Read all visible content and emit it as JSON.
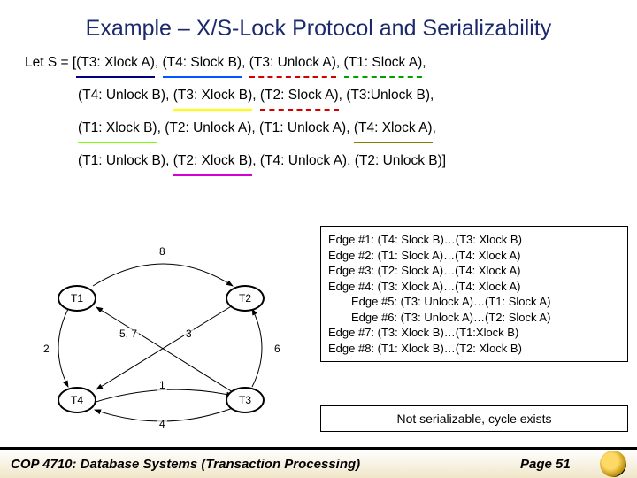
{
  "title": "Example – X/S-Lock Protocol and Serializability",
  "schedule": {
    "prefix": "Let S = [",
    "line1": {
      "a": "(T3: Xlock A)",
      "sep1": ", ",
      "b": "(T4: Slock B)",
      "sep2": ", ",
      "c": "(T3: Unlock A)",
      "sep3": ", ",
      "d": "(T1: Slock A)",
      "end": ","
    },
    "line2": {
      "a": "(T4: Unlock B)",
      "sep1": ", ",
      "b": "(T3: Xlock B)",
      "sep2": ", ",
      "c": "(T2: Slock A)",
      "sep3": ", ",
      "d": "(T3:Unlock B)",
      "end": ","
    },
    "line3": {
      "a": "(T1: Xlock B)",
      "sep1": ", ",
      "b": "(T2: Unlock A)",
      "sep2": ", ",
      "c": "(T1: Unlock A)",
      "sep3": ", ",
      "d": "(T4: Xlock A)",
      "end": ","
    },
    "line4": {
      "a": "(T1: Unlock B)",
      "sep1": ", ",
      "b": "(T2: Xlock B)",
      "sep2": ", ",
      "c": "(T4: Unlock A)",
      "sep3": ", ",
      "d": "(T2: Unlock B)",
      "end": "]"
    }
  },
  "graph": {
    "nodes": {
      "t1": "T1",
      "t2": "T2",
      "t3": "T3",
      "t4": "T4"
    },
    "labels": {
      "e8": "8",
      "e57": "5, 7",
      "e3": "3",
      "e2": "2",
      "e6": "6",
      "e1": "1",
      "e4": "4"
    }
  },
  "edges": {
    "e1": "Edge #1: (T4: Slock B)…(T3: Xlock B)",
    "e2": "Edge #2: (T1: Slock A)…(T4: Xlock A)",
    "e3": "Edge #3: (T2: Slock A)…(T4: Xlock A)",
    "e4": "Edge #4: (T3: Xlock A)…(T4: Xlock A)",
    "e5": "Edge #5: (T3: Unlock A)…(T1: Slock A)",
    "e6": "Edge #6: (T3: Unlock A)…(T2: Slock A)",
    "e7": "Edge #7: (T3: Xlock B)…(T1:Xlock B)",
    "e8": "Edge #8: (T1: Xlock B)…(T2: Xlock B)"
  },
  "verdict": "Not serializable, cycle exists",
  "footer": {
    "course": "COP 4710: Database Systems  (Transaction Processing)",
    "page": "Page 51"
  }
}
